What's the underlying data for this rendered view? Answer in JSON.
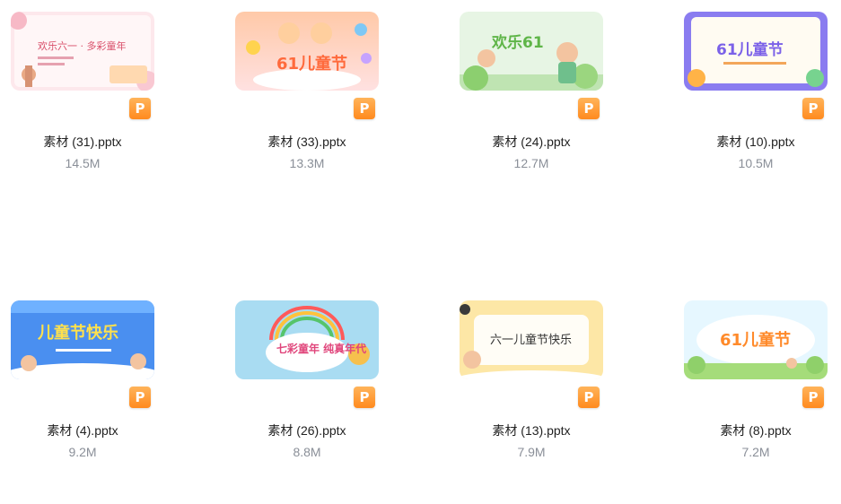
{
  "files": [
    {
      "name": "素材 (31).pptx",
      "size": "14.5M",
      "slide_title": "欢乐六一 · 多彩童年",
      "type_badge": "P"
    },
    {
      "name": "素材 (33).pptx",
      "size": "13.3M",
      "slide_title": "61儿童节",
      "type_badge": "P"
    },
    {
      "name": "素材 (24).pptx",
      "size": "12.7M",
      "slide_title": "欢乐61",
      "type_badge": "P"
    },
    {
      "name": "素材 (10).pptx",
      "size": "10.5M",
      "slide_title": "61儿童节",
      "type_badge": "P"
    },
    {
      "name": "素材 (4).pptx",
      "size": "9.2M",
      "slide_title": "儿童节快乐",
      "type_badge": "P"
    },
    {
      "name": "素材 (26).pptx",
      "size": "8.8M",
      "slide_title": "七彩童年 纯真年代",
      "type_badge": "P"
    },
    {
      "name": "素材 (13).pptx",
      "size": "7.9M",
      "slide_title": "六一儿童节快乐",
      "type_badge": "P"
    },
    {
      "name": "素材 (8).pptx",
      "size": "7.2M",
      "slide_title": "61儿童节",
      "type_badge": "P"
    }
  ]
}
